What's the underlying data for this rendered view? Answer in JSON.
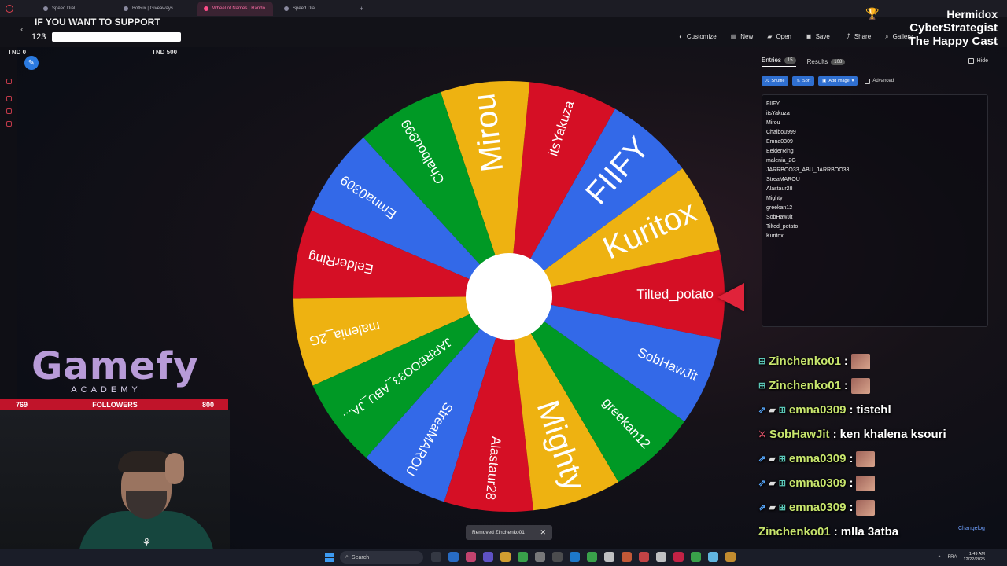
{
  "browser": {
    "tabs": [
      {
        "label": "Speed Dial",
        "active": false
      },
      {
        "label": "BotRix | Giveaways",
        "active": false
      },
      {
        "label": "Wheel of Names | Rando",
        "active": true
      },
      {
        "label": "Speed Dial",
        "active": false
      }
    ],
    "new_tab": "+"
  },
  "overlay": {
    "support_text": "IF YOU WANT TO SUPPORT",
    "counter_value": "123",
    "goal_min": "TND 0",
    "goal_max": "TND 500",
    "streamer_name": "Hermidox",
    "title_line2": "CyberStrategist",
    "title_line3": "The Happy Cast",
    "gamefy_logo": "Gamefy",
    "gamefy_sub": "ACADEMY",
    "followers_current": "769",
    "followers_label": "FOLLOWERS",
    "followers_goal": "800"
  },
  "toolbar": {
    "items": [
      {
        "label": "Customize",
        "icon": "palette-icon"
      },
      {
        "label": "New",
        "icon": "file-icon"
      },
      {
        "label": "Open",
        "icon": "folder-icon"
      },
      {
        "label": "Save",
        "icon": "save-icon"
      },
      {
        "label": "Share",
        "icon": "share-icon"
      },
      {
        "label": "Gallery",
        "icon": "search-icon"
      }
    ]
  },
  "wheel": {
    "colors": [
      "#3369e8",
      "#009925",
      "#eeb211",
      "#d50f25"
    ],
    "entries": [
      "Tilted_potato",
      "Kuritox",
      "FIIFY",
      "itsYakuza",
      "Mirou",
      "Chalbou999",
      "Emna0309",
      "EelderRing",
      "malenia_2G",
      "JARRBOO33_ABU_JARRBOO33",
      "StreaMAROU",
      "Alastaur28",
      "Mighty",
      "greekan12",
      "SobHawJit"
    ],
    "selected": "Tilted_potato"
  },
  "panel": {
    "tab_entries": "Entries",
    "entries_count": "15",
    "tab_results": "Results",
    "results_count": "108",
    "hide_label": "Hide",
    "shuffle_label": "Shuffle",
    "sort_label": "Sort",
    "add_image_label": "Add image",
    "advanced_label": "Advanced",
    "entries": [
      "FIIFY",
      "itsYakuza",
      "Mirou",
      "Chalbou999",
      "Emna0309",
      "EelderRing",
      "malenia_2G",
      "JARRBOO33_ABU_JARRBOO33",
      "StreaMAROU",
      "Alastaur28",
      "Mighty",
      "greekan12",
      "SobHawJit",
      "Tilted_potato",
      "Kuritox"
    ],
    "changelog": "Changelog"
  },
  "chat": [
    {
      "nick": "Zinchenko01",
      "sep": ":",
      "msg": "",
      "emote": true,
      "icons": [
        "badge-icon"
      ]
    },
    {
      "nick": "Zinchenko01",
      "sep": ":",
      "msg": "",
      "emote": true,
      "icons": [
        "badge-icon"
      ]
    },
    {
      "nick": "emna0309",
      "sep": ":",
      "msg": "tistehl",
      "emote": false,
      "icons": [
        "arrow-icon",
        "book-icon",
        "badge-icon"
      ]
    },
    {
      "nick": "SobHawJit",
      "sep": ":",
      "msg": "ken khalena ksouri",
      "emote": false,
      "icons": [
        "sword-icon"
      ]
    },
    {
      "nick": "emna0309",
      "sep": ":",
      "msg": "",
      "emote": true,
      "icons": [
        "arrow-icon",
        "book-icon",
        "badge-icon"
      ]
    },
    {
      "nick": "emna0309",
      "sep": ":",
      "msg": "",
      "emote": true,
      "icons": [
        "arrow-icon",
        "book-icon",
        "badge-icon"
      ]
    },
    {
      "nick": "emna0309",
      "sep": ":",
      "msg": "",
      "emote": true,
      "icons": [
        "arrow-icon",
        "book-icon",
        "badge-icon"
      ]
    },
    {
      "nick": "Zinchenko01",
      "sep": ":",
      "msg": "mlla 3atba",
      "emote": false,
      "icons": []
    }
  ],
  "toast": {
    "text": "Removed Zinchenko01",
    "close": "✕"
  },
  "taskbar": {
    "search_label": "Search",
    "language": "FRA",
    "time": "1:49 AM",
    "date": "12/22/2025"
  }
}
